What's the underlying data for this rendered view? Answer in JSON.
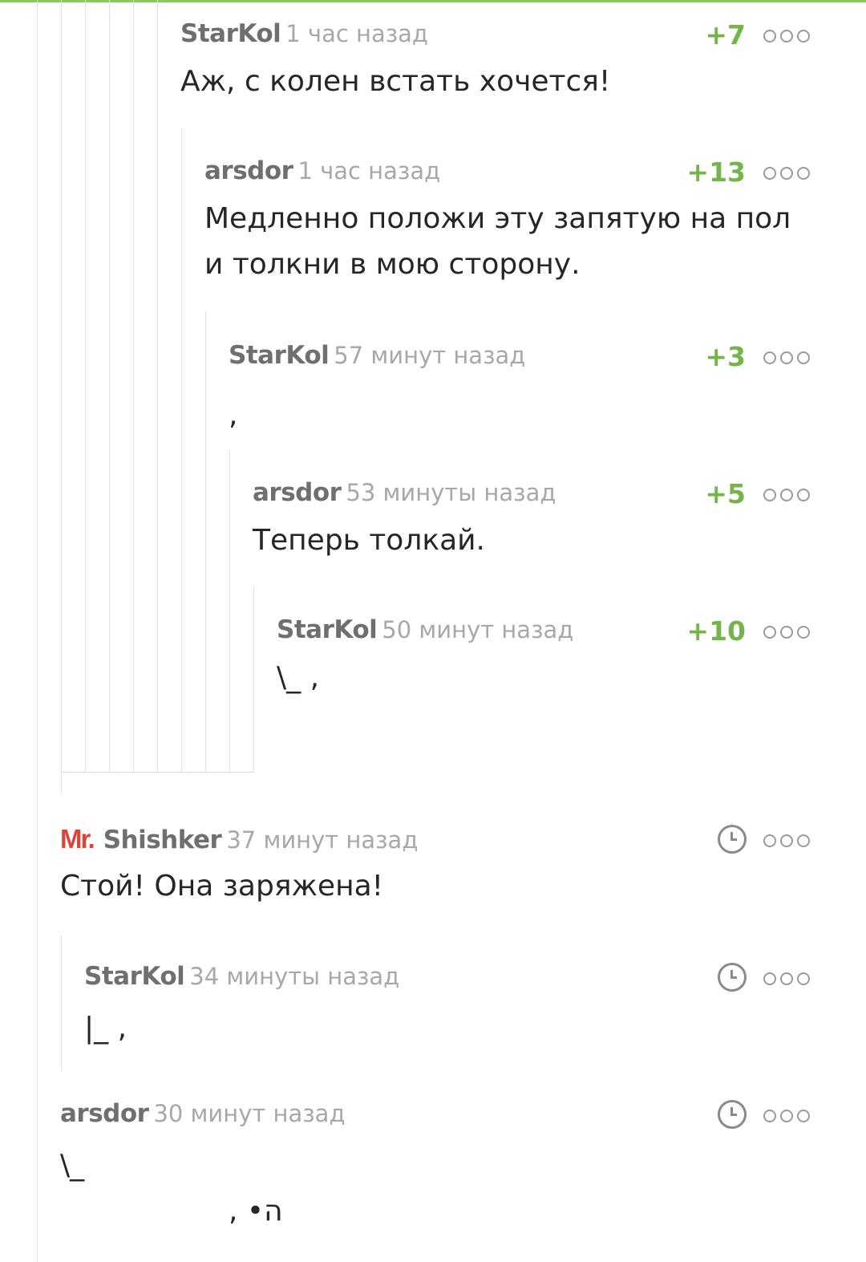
{
  "comments": [
    {
      "author": "StarKol",
      "time": "1 час назад",
      "rating": "+7",
      "text": "Аж, с колен встать хочется!"
    },
    {
      "author": "arsdor",
      "time": "1 час назад",
      "rating": "+13",
      "text_line1": "Медленно положи эту запятую на пол",
      "text_line2": "и толкни в мою сторону."
    },
    {
      "author": "StarKol",
      "time": "57 минут назад",
      "rating": "+3",
      "text": ","
    },
    {
      "author": "arsdor",
      "time": "53 минуты назад",
      "rating": "+5",
      "text": "Теперь толкай."
    },
    {
      "author": "StarKol",
      "time": "50 минут назад",
      "rating": "+10",
      "text": "\\_ ,"
    },
    {
      "badge": "Mr.",
      "author": "Shishker",
      "time": "37 минут назад",
      "text": "Стой! Она заряжена!"
    },
    {
      "author": "StarKol",
      "time": "34 минуты назад",
      "text": "|_ ,"
    },
    {
      "author": "arsdor",
      "time": "30 минут назад",
      "text_line1": "\\_",
      "text_line2": ", •ה"
    }
  ],
  "colors": {
    "rating": "#74b54a",
    "accent_bar": "#8ac858",
    "badge": "#d8453a"
  },
  "icons": {
    "more": "more-options-icon",
    "pending": "clock-icon"
  }
}
